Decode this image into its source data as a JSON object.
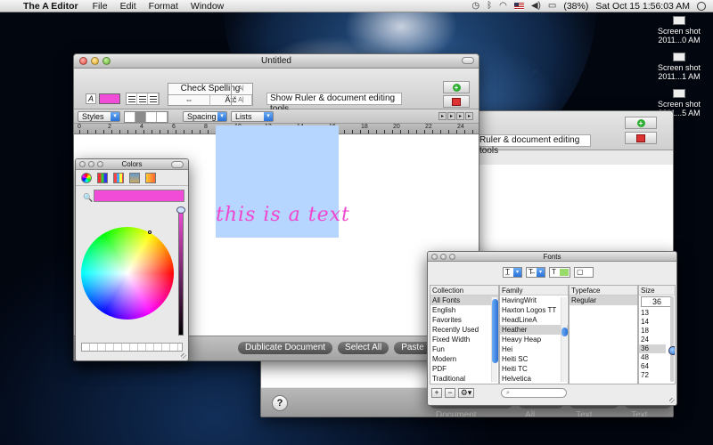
{
  "menubar": {
    "app_name": "The A Editor",
    "menus": [
      "File",
      "Edit",
      "Format",
      "Window"
    ],
    "battery": "(38%)",
    "clock": "Sat Oct 15  1:56:03 AM"
  },
  "desktop_files": [
    {
      "line1": "Screen shot",
      "line2": "2011...0 AM"
    },
    {
      "line1": "Screen shot",
      "line2": "2011...1 AM"
    },
    {
      "line1": "Screen shot",
      "line2": "2011...5 AM"
    }
  ],
  "main_window": {
    "title": "Untitled",
    "check_spelling": "Check Spelling",
    "tool_text_1": "⇔",
    "tool_text_2": "Ätč",
    "tool_side_1": "A|",
    "tool_side_2": "A|",
    "ruler_button": "Show Ruler & document editing tools",
    "styles_popup": "Styles",
    "spacing_popup": "Spacing",
    "lists_popup": "Lists",
    "font_color": "#f04cd8",
    "ruler_numbers": [
      "0",
      "2",
      "4",
      "6",
      "8",
      "10",
      "12",
      "14",
      "16",
      "18",
      "20",
      "22",
      "24"
    ],
    "doc_text": "this is a text",
    "bottom_buttons": [
      "Dublicate Document",
      "Select All",
      "Paste Text"
    ]
  },
  "back_window": {
    "ruler_button": "Ruler & document editing tools",
    "help": "?",
    "bottom_buttons": [
      "Dublicate Document",
      "Select All",
      "Paste Text",
      "Copy Text"
    ]
  },
  "colors_panel": {
    "title": "Colors",
    "current_color": "#f04cd8"
  },
  "fonts_panel": {
    "title": "Fonts",
    "headers": {
      "collection": "Collection",
      "family": "Family",
      "typeface": "Typeface",
      "size": "Size"
    },
    "collections": [
      "All Fonts",
      "English",
      "Favorites",
      "Recently Used",
      "Fixed Width",
      "Fun",
      "Modern",
      "PDF",
      "Traditional"
    ],
    "families": [
      "HavingWrit",
      "Haxton Logos TT",
      "HeadLineA",
      "Heather",
      "Heavy Heap",
      "Hei",
      "Heiti SC",
      "Heiti TC",
      "Helvetica"
    ],
    "typefaces": [
      "Regular"
    ],
    "size_value": "36",
    "sizes": [
      "13",
      "14",
      "18",
      "24",
      "36",
      "48",
      "64",
      "72"
    ],
    "selected_collection": "All Fonts",
    "selected_family": "Heather",
    "selected_typeface": "Regular",
    "selected_size": "36"
  }
}
